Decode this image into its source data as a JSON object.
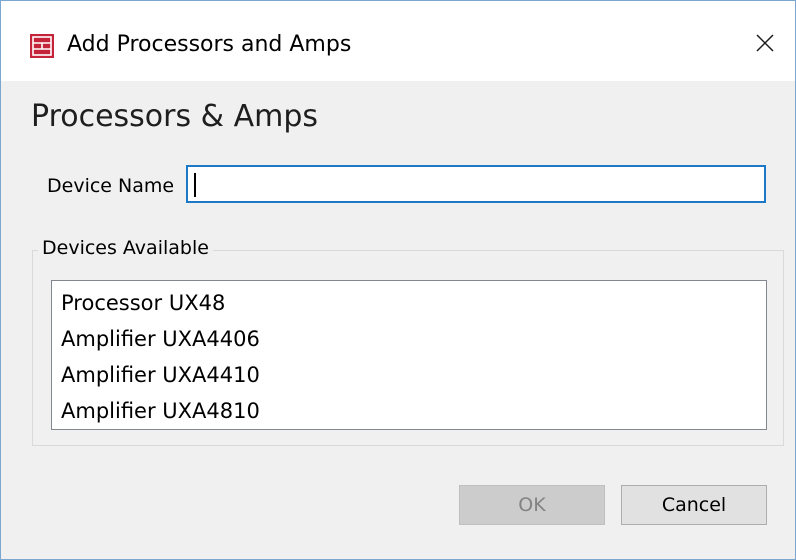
{
  "window": {
    "title": "Add Processors and Amps",
    "app_icon": "processor-rack-icon",
    "close_icon": "close-icon"
  },
  "dialog": {
    "heading": "Processors & Amps",
    "device_name": {
      "label": "Device Name",
      "value": ""
    },
    "devices_available": {
      "legend": "Devices Available",
      "items": [
        {
          "label": "Processor UX48"
        },
        {
          "label": "Amplifier UXA4406"
        },
        {
          "label": "Amplifier UXA4410"
        },
        {
          "label": "Amplifier UXA4810"
        }
      ]
    },
    "buttons": {
      "ok_label": "OK",
      "ok_enabled": false,
      "cancel_label": "Cancel"
    }
  },
  "colors": {
    "accent": "#1b79c8",
    "icon_red": "#c4233a",
    "window_border": "#7aa7cf",
    "dialog_background": "#f0f0f0"
  }
}
